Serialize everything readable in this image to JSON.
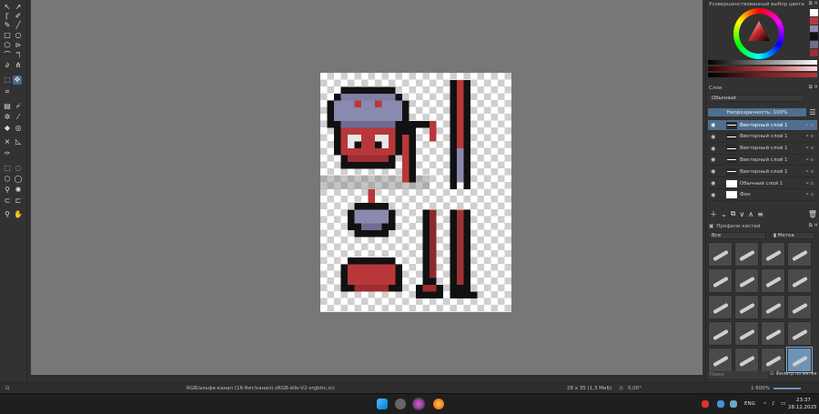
{
  "dockers": {
    "color_selector": {
      "title": "Усовершенствованный выбор цвета"
    },
    "layers": {
      "title": "Слои",
      "blend_mode": "Обычный",
      "opacity_label": "Непрозрачность: 100%",
      "items": [
        {
          "name": "Векторный слой 1",
          "selected": true,
          "props": "⚭ α"
        },
        {
          "name": "Векторный слой 1",
          "selected": false,
          "props": "⚭ α"
        },
        {
          "name": "Векторный слой 1",
          "selected": false,
          "props": "⚭ α"
        },
        {
          "name": "Векторный слой 1",
          "selected": false,
          "props": "⚭ α"
        },
        {
          "name": "Векторный слой 1",
          "selected": false,
          "props": "⚭ α"
        },
        {
          "name": "Обычный слой 1",
          "selected": false,
          "props": "⚭ α"
        },
        {
          "name": "Фон",
          "selected": false,
          "props": "⚭ α"
        }
      ]
    },
    "brushes": {
      "title": "Профили кистей",
      "filter_value": "Все",
      "tag_label": "Метка",
      "search_placeholder": "Поиск",
      "filter_by_tag": "Фильтр по метке"
    }
  },
  "statusbar": {
    "color_info": "RGB/альфа-канал (16-бит/канал)  sRGB-elle-V2-srgbtrc.icc",
    "image_size": "28 x 35 (1,3 МиБ)",
    "rotation": "0,00°",
    "zoom": "1 600%"
  },
  "taskbar": {
    "lang": "ENG",
    "time": "23:37",
    "date": "28.12.2025"
  },
  "colors": {
    "canvas_bg": "#777777",
    "accent": "#4f6f8f",
    "sprite_red": "#b8383a",
    "sprite_lavender": "#8a8ab0"
  }
}
